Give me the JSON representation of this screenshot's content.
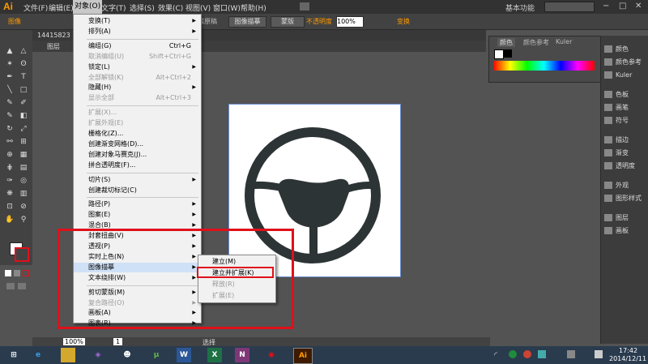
{
  "app": {
    "logo": "Ai",
    "workspace": "基本功能",
    "search_icon": "search-icon"
  },
  "menubar": {
    "items": [
      "文件(F)",
      "编辑(E)",
      "对象(O)",
      "文字(T)",
      "选择(S)",
      "效果(C)",
      "视图(V)",
      "窗口(W)",
      "帮助(H)"
    ],
    "active": "对象(O)"
  },
  "controlbar": {
    "label": "图像",
    "trace_edit": "编辑原稿",
    "trace_btn": "图像描摹",
    "mask_btn": "蒙版",
    "opacity_label": "不透明度",
    "opacity_value": "100%",
    "transform": "变换"
  },
  "tabs": {
    "filename": "14415823",
    "doc": "14415823",
    "doc_title": "图层"
  },
  "object_menu": {
    "items": [
      {
        "label": "变换(T)",
        "shortcut": "",
        "submenu": true,
        "disabled": false
      },
      {
        "label": "排列(A)",
        "shortcut": "",
        "submenu": true,
        "disabled": false
      },
      {
        "label": "编组(G)",
        "shortcut": "Ctrl+G",
        "submenu": false,
        "disabled": false
      },
      {
        "label": "取消编组(U)",
        "shortcut": "Shift+Ctrl+G",
        "submenu": false,
        "disabled": true
      },
      {
        "label": "锁定(L)",
        "shortcut": "",
        "submenu": true,
        "disabled": false
      },
      {
        "label": "全部解锁(K)",
        "shortcut": "Alt+Ctrl+2",
        "submenu": false,
        "disabled": true
      },
      {
        "label": "隐藏(H)",
        "shortcut": "",
        "submenu": true,
        "disabled": false
      },
      {
        "label": "显示全部",
        "shortcut": "Alt+Ctrl+3",
        "submenu": false,
        "disabled": true
      },
      {
        "label": "扩展(X)...",
        "shortcut": "",
        "submenu": false,
        "disabled": true
      },
      {
        "label": "扩展外观(E)",
        "shortcut": "",
        "submenu": false,
        "disabled": true
      },
      {
        "label": "栅格化(Z)...",
        "shortcut": "",
        "submenu": false,
        "disabled": false
      },
      {
        "label": "创建渐变网格(D)...",
        "shortcut": "",
        "submenu": false,
        "disabled": false
      },
      {
        "label": "创建对象马赛克(J)...",
        "shortcut": "",
        "submenu": false,
        "disabled": false
      },
      {
        "label": "拼合透明度(F)...",
        "shortcut": "",
        "submenu": false,
        "disabled": false
      },
      {
        "label": "切片(S)",
        "shortcut": "",
        "submenu": true,
        "disabled": false
      },
      {
        "label": "创建裁切标记(C)",
        "shortcut": "",
        "submenu": false,
        "disabled": false
      },
      {
        "label": "路径(P)",
        "shortcut": "",
        "submenu": true,
        "disabled": false
      },
      {
        "label": "图案(E)",
        "shortcut": "",
        "submenu": true,
        "disabled": false
      },
      {
        "label": "混合(B)",
        "shortcut": "",
        "submenu": true,
        "disabled": false
      },
      {
        "label": "封套扭曲(V)",
        "shortcut": "",
        "submenu": true,
        "disabled": false
      },
      {
        "label": "透视(P)",
        "shortcut": "",
        "submenu": true,
        "disabled": false
      },
      {
        "label": "实时上色(N)",
        "shortcut": "",
        "submenu": true,
        "disabled": false
      },
      {
        "label": "图像描摹",
        "shortcut": "",
        "submenu": true,
        "disabled": false,
        "highlight": true
      },
      {
        "label": "文本绕排(W)",
        "shortcut": "",
        "submenu": true,
        "disabled": false
      },
      {
        "label": "剪切蒙版(M)",
        "shortcut": "",
        "submenu": true,
        "disabled": false
      },
      {
        "label": "复合路径(O)",
        "shortcut": "",
        "submenu": true,
        "disabled": true
      },
      {
        "label": "画板(A)",
        "shortcut": "",
        "submenu": true,
        "disabled": false
      },
      {
        "label": "图表(R)",
        "shortcut": "",
        "submenu": true,
        "disabled": false
      }
    ]
  },
  "trace_submenu": {
    "items": [
      {
        "label": "建立(M)",
        "disabled": false
      },
      {
        "label": "建立并扩展(K)",
        "disabled": false,
        "boxed": true
      },
      {
        "label": "释放(R)",
        "disabled": true
      },
      {
        "label": "扩展(E)",
        "disabled": true
      }
    ]
  },
  "color_panel": {
    "tabs": [
      "颜色",
      "颜色参考",
      "Kuler"
    ]
  },
  "dock": {
    "items": [
      "颜色",
      "颜色参考",
      "Kuler",
      "色板",
      "画笔",
      "符号",
      "描边",
      "渐变",
      "透明度",
      "外观",
      "图形样式",
      "图层",
      "画板"
    ]
  },
  "statusbar": {
    "zoom": "100%",
    "page": "1",
    "status": "选择"
  },
  "taskbar": {
    "apps": [
      "IE",
      "Explorer",
      "VS",
      "QQ",
      "uTorrent",
      "W",
      "X",
      "N",
      "163",
      "Ai"
    ],
    "time": "17:42",
    "date": "2014/12/11"
  },
  "colors": {
    "accent_red": "#e0101a",
    "ai_orange": "#ff9a00",
    "menu_highlight": "#cfe1f7"
  }
}
